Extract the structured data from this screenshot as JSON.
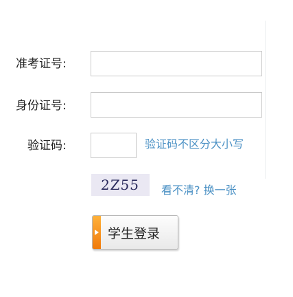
{
  "form": {
    "exam_id_label": "准考证号:",
    "exam_id_value": "",
    "id_card_label": "身份证号:",
    "id_card_value": "",
    "captcha_label": "验证码:",
    "captcha_value": "",
    "case_hint": "验证码不区分大小写",
    "captcha_image_text": "2Z55",
    "refresh_text": "看不清? 换一张",
    "login_label": "学生登录"
  },
  "colors": {
    "hint": "#4a90c4",
    "button_tab": "#f5901e"
  }
}
